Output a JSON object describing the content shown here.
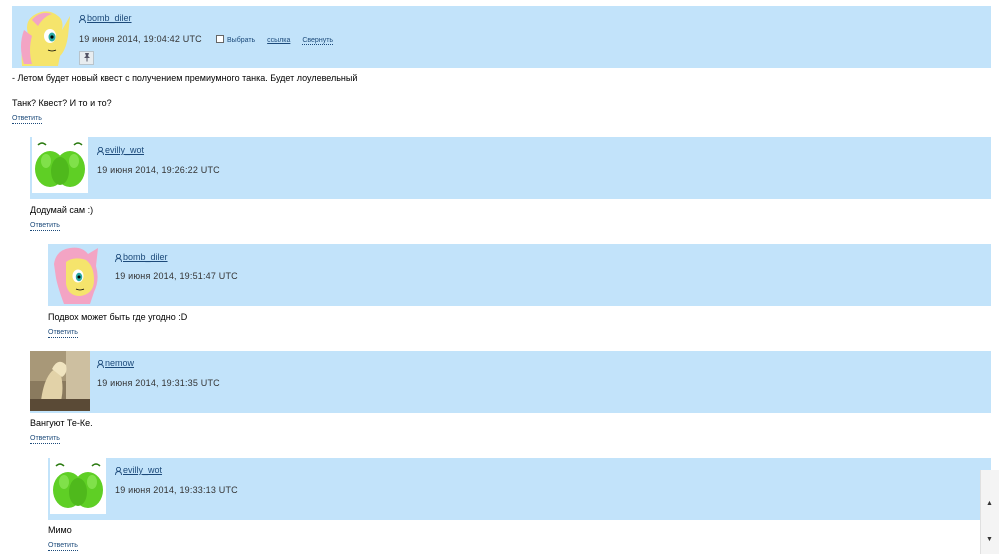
{
  "comments": [
    {
      "username": "bomb_diler",
      "date": "19 июня 2014, 19:04:42 UTC",
      "actions": {
        "select": "Выбрать",
        "link": "ссылка",
        "collapse": "Свернуть"
      },
      "body": [
        "- Летом будет новый квест с получением премиумного танка. Будет лоулевельный",
        "Танк? Квест? И то и то?"
      ],
      "reply": "Ответить",
      "avatar": "yellow-pony-avatar"
    },
    {
      "username": "evilly_wot",
      "date": "19 июня 2014, 19:26:22 UTC",
      "body": [
        "Додумай сам :)"
      ],
      "reply": "Ответить",
      "avatar": "green-creature-avatar"
    },
    {
      "username": "bomb_diler",
      "date": "19 июня 2014, 19:51:47 UTC",
      "body": [
        "Подвох может быть где угодно :D"
      ],
      "reply": "Ответить",
      "avatar": "yellow-pony-avatar"
    },
    {
      "username": "nemow",
      "date": "19 июня 2014, 19:31:35 UTC",
      "body": [
        "Вангуют Те-Ке."
      ],
      "reply": "Ответить",
      "avatar": "photo-avatar"
    },
    {
      "username": "evilly_wot",
      "date": "19 июня 2014, 19:33:13 UTC",
      "body": [
        "Мимо"
      ],
      "reply": "Ответить",
      "avatar": "green-creature-avatar"
    }
  ],
  "colors": {
    "header_bg": "#c2e3fa",
    "link": "#1c4a7a"
  }
}
